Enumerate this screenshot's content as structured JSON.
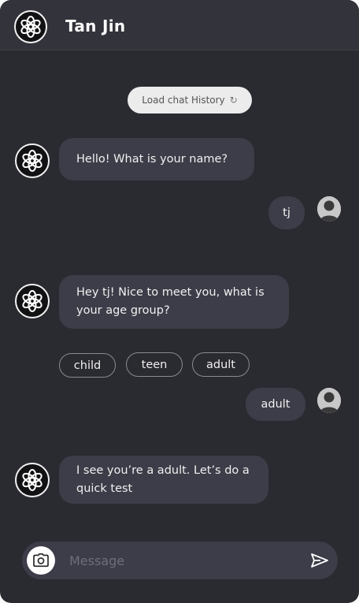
{
  "header": {
    "title": "Tan Jin",
    "logo_icon": "openai-logo-icon"
  },
  "history": {
    "label": "Load chat History",
    "icon": "refresh-icon"
  },
  "messages": [
    {
      "sender": "bot",
      "text": "Hello! What is your name?"
    },
    {
      "sender": "user",
      "text": "tj"
    },
    {
      "sender": "bot",
      "text": "Hey tj! Nice to meet you, what is your age group?"
    },
    {
      "sender": "user",
      "text": "adult"
    },
    {
      "sender": "bot",
      "text": "I see you’re a adult. Let’s do a quick test"
    }
  ],
  "options": [
    "child",
    "teen",
    "adult"
  ],
  "composer": {
    "placeholder": "Message",
    "camera_icon": "camera-icon",
    "send_icon": "send-icon"
  },
  "colors": {
    "background": "#2a2a31",
    "header": "#33333b",
    "bubble": "#3d3d49",
    "pill": "#ececec"
  }
}
